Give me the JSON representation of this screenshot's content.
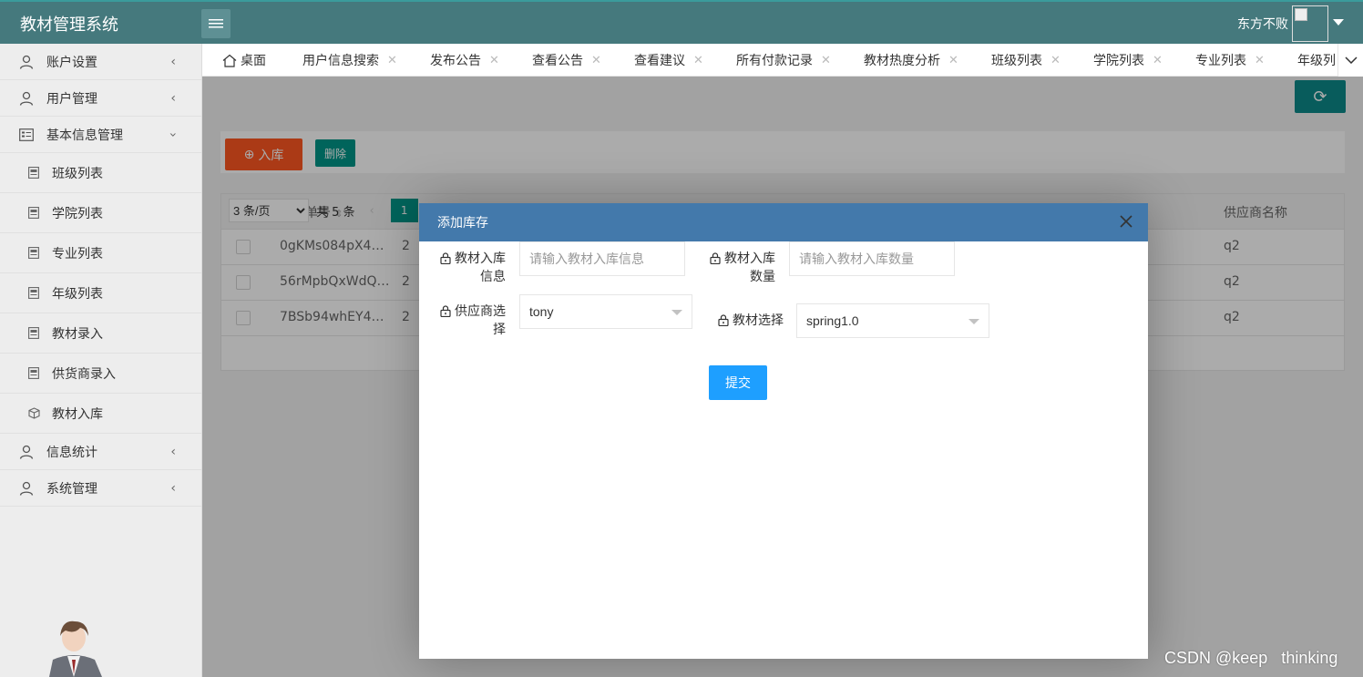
{
  "header": {
    "app_title": "教材管理系统",
    "user_name": "东方不败"
  },
  "sidebar": {
    "items": [
      {
        "label": "账户设置",
        "icon": "user-icon",
        "state": "collapsed"
      },
      {
        "label": "用户管理",
        "icon": "user-icon",
        "state": "collapsed"
      },
      {
        "label": "基本信息管理",
        "icon": "table-icon",
        "state": "expanded"
      },
      {
        "label": "信息统计",
        "icon": "user-icon",
        "state": "collapsed"
      },
      {
        "label": "系统管理",
        "icon": "user-icon",
        "state": "collapsed"
      }
    ],
    "sub_items": [
      {
        "label": "班级列表",
        "icon": "file-icon"
      },
      {
        "label": "学院列表",
        "icon": "file-icon"
      },
      {
        "label": "专业列表",
        "icon": "file-icon"
      },
      {
        "label": "年级列表",
        "icon": "file-icon"
      },
      {
        "label": "教材录入",
        "icon": "file-icon"
      },
      {
        "label": "供货商录入",
        "icon": "file-icon"
      },
      {
        "label": "教材入库",
        "icon": "box-icon"
      }
    ]
  },
  "tabs": [
    {
      "label": "桌面",
      "icon": "home-icon"
    },
    {
      "label": "用户信息搜索",
      "closable": true
    },
    {
      "label": "发布公告",
      "closable": true
    },
    {
      "label": "查看公告",
      "closable": true
    },
    {
      "label": "查看建议",
      "closable": true
    },
    {
      "label": "所有付款记录",
      "closable": true
    },
    {
      "label": "教材热度分析",
      "closable": true
    },
    {
      "label": "班级列表",
      "closable": true
    },
    {
      "label": "学院列表",
      "closable": true
    },
    {
      "label": "专业列表",
      "closable": true
    },
    {
      "label": "年级列"
    }
  ],
  "toolbar": {
    "add_label": "入库",
    "delete_label": "删除"
  },
  "table": {
    "columns": [
      "入库单号",
      "供应商名称"
    ],
    "rows": [
      {
        "id": "0gKMs084pX4…",
        "mid": "2",
        "supplier": "q2"
      },
      {
        "id": "56rMpbQxWdQ…",
        "mid": "2",
        "supplier": "q2"
      },
      {
        "id": "7BSb94whEY4…",
        "mid": "2",
        "supplier": "q2"
      }
    ],
    "pager": {
      "page_size": "3 条/页",
      "total": "共 5 条",
      "prev": "‹",
      "current_page": "1"
    }
  },
  "modal": {
    "title": "添加库存",
    "fields": {
      "info_label_1": "教材入库",
      "info_label_2": "信息",
      "info_placeholder": "请输入教材入库信息",
      "qty_label_1": "教材入库",
      "qty_label_2": "数量",
      "qty_placeholder": "请输入教材入库数量",
      "supplier_label_1": "供应商选",
      "supplier_label_2": "择",
      "supplier_value": "tony",
      "book_label": "教材选择",
      "book_value": "spring1.0"
    },
    "submit_label": "提交"
  },
  "watermark": "CSDN @keep   thinking",
  "colors": {
    "header": "#45797d",
    "modal_title": "#4379ab",
    "submit": "#1e9fff",
    "add_button": "#ff5722",
    "teal": "#009688"
  }
}
